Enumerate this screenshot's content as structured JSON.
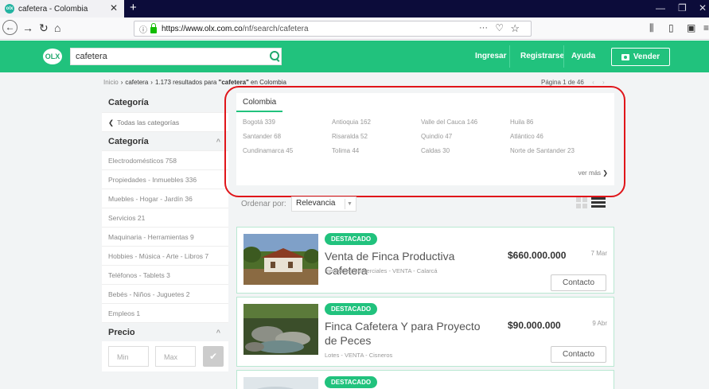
{
  "browser": {
    "tab_title": "cafetera - Colombia",
    "favicon_text": "olx",
    "url_domain": "https://www.olx.com.co",
    "url_path": "/nf/search/cafetera"
  },
  "header": {
    "logo": "OLX",
    "search_value": "cafetera",
    "nav_links": [
      "Ingresar",
      "Registrarse",
      "Ayuda"
    ],
    "sell_label": "Vender",
    "accent_color": "#21c27d"
  },
  "breadcrumb": {
    "home": "Inicio",
    "category": "cafetera",
    "results_prefix": "1.173 resultados para ",
    "query_quoted": "\"cafetera\"",
    "results_suffix": " en Colombia"
  },
  "pagination": {
    "label": "Página 1 de 46"
  },
  "sidebar": {
    "categoria_title": "Categoría",
    "all_categories": "Todas las categorías",
    "categoria_title_2": "Categoría",
    "categories": [
      "Electrodomésticos 758",
      "Propiedades - Inmuebles 336",
      "Muebles - Hogar - Jardín 36",
      "Servicios 21",
      "Maquinaria - Herramientas 9",
      "Hobbies - Música - Arte - Libros 7",
      "Teléfonos - Tablets 3",
      "Bebés - Niños - Juguetes 2",
      "Empleos 1"
    ],
    "price_title": "Precio",
    "min_placeholder": "Min",
    "max_placeholder": "Max"
  },
  "locations": {
    "tab": "Colombia",
    "items": [
      "Bogotá 339",
      "Antioquia 162",
      "Valle del Cauca 146",
      "Huila 86",
      "Santander 68",
      "Risaralda 52",
      "Quindío 47",
      "Atlántico 46",
      "Cundinamarca 45",
      "Tolima 44",
      "Caldas 30",
      "Norte de Santander 23"
    ],
    "more": "ver más"
  },
  "sort": {
    "label": "Ordenar por:",
    "value": "Relevancia"
  },
  "listings": [
    {
      "badge": "DESTACADO",
      "title": "Venta de Finca Productiva Cafetera",
      "meta": "Inmuebles Comerciales - VENTA - Calarcá",
      "price": "$660.000.000",
      "date": "7 Mar",
      "contact": "Contacto"
    },
    {
      "badge": "DESTACADO",
      "title": "Finca Cafetera Y para Proyecto de Peces",
      "meta": "Lotes - VENTA - Cisneros",
      "price": "$90.000.000",
      "date": "9 Abr",
      "contact": "Contacto"
    },
    {
      "badge": "DESTACADO"
    }
  ]
}
